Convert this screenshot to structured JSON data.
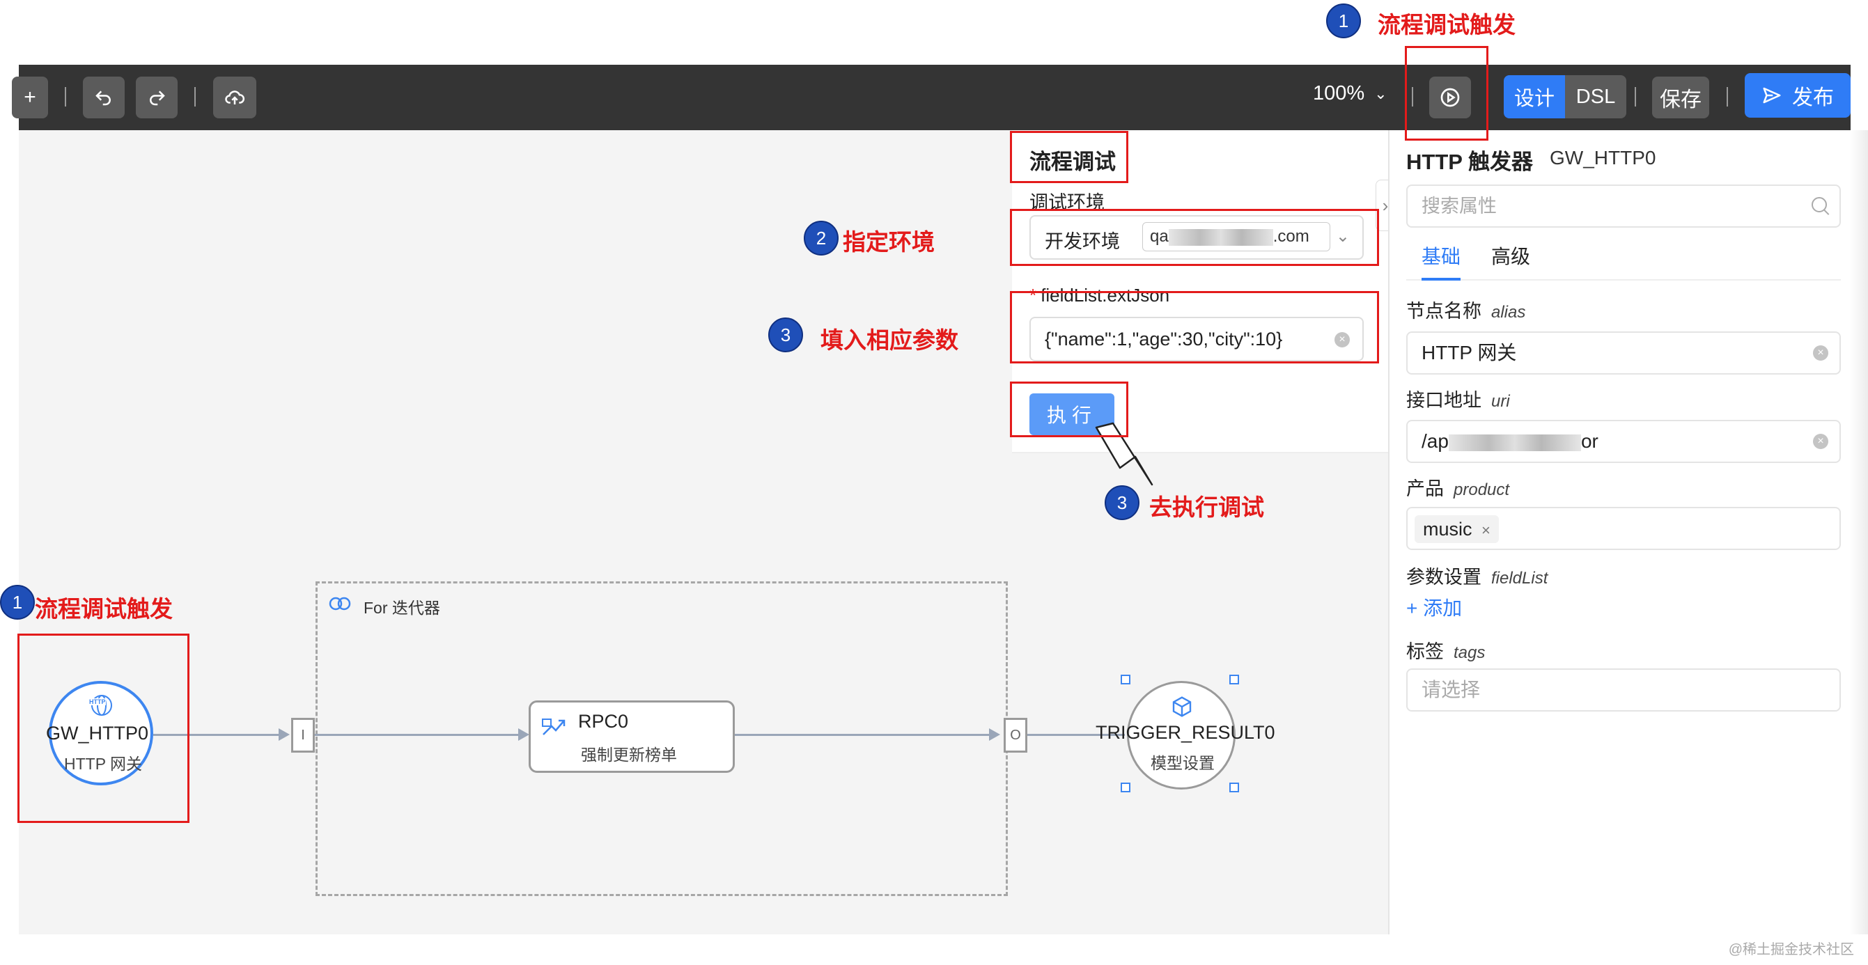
{
  "toolbar": {
    "zoom": "100%",
    "design_label": "设计",
    "dsl_label": "DSL",
    "save_label": "保存",
    "publish_label": "发布"
  },
  "debug_panel": {
    "title": "流程调试",
    "env_label": "调试环境",
    "env_key": "开发环境",
    "env_value_prefix": "qa",
    "env_value_suffix": ".com",
    "param_label": "fieldList.extJson",
    "param_value": "{\"name\":1,\"age\":30,\"city\":10}",
    "run_label": "执行"
  },
  "props_panel": {
    "title": "HTTP 触发器",
    "node_id": "GW_HTTP0",
    "search_placeholder": "搜索属性",
    "tabs": [
      "基础",
      "高级"
    ],
    "fields": {
      "node_name_label": "节点名称",
      "node_name_key": "alias",
      "node_name_value": "HTTP 网关",
      "uri_label": "接口地址",
      "uri_key": "uri",
      "uri_value_prefix": "/ap",
      "uri_value_suffix": "or",
      "product_label": "产品",
      "product_key": "product",
      "product_tag": "music",
      "params_label": "参数设置",
      "params_key": "fieldList",
      "add_label": "添加",
      "tags_label": "标签",
      "tags_key": "tags",
      "tags_placeholder": "请选择"
    }
  },
  "flow": {
    "gw_node": {
      "icon_text": "HTTP",
      "name": "GW_HTTP0",
      "desc": "HTTP 网关"
    },
    "for_box": {
      "label": "For 迭代器"
    },
    "port_in": "I",
    "port_out": "O",
    "rpc_node": {
      "name": "RPC0",
      "desc": "强制更新榜单"
    },
    "result_node": {
      "name": "TRIGGER_RESULT0",
      "desc": "模型设置"
    }
  },
  "annotations": [
    {
      "num": "1",
      "text": "流程调试触发"
    },
    {
      "num": "2",
      "text": "指定环境"
    },
    {
      "num": "3",
      "text": "填入相应参数"
    },
    {
      "num": "3",
      "text": "去执行调试"
    },
    {
      "num": "1",
      "text": "流程调试触发"
    }
  ],
  "watermark": "@稀土掘金技术社区",
  "colors": {
    "accent": "#2f7cf6",
    "annotation": "#e31b1b",
    "toolbar": "#343434",
    "badge": "#1f4fb8"
  }
}
